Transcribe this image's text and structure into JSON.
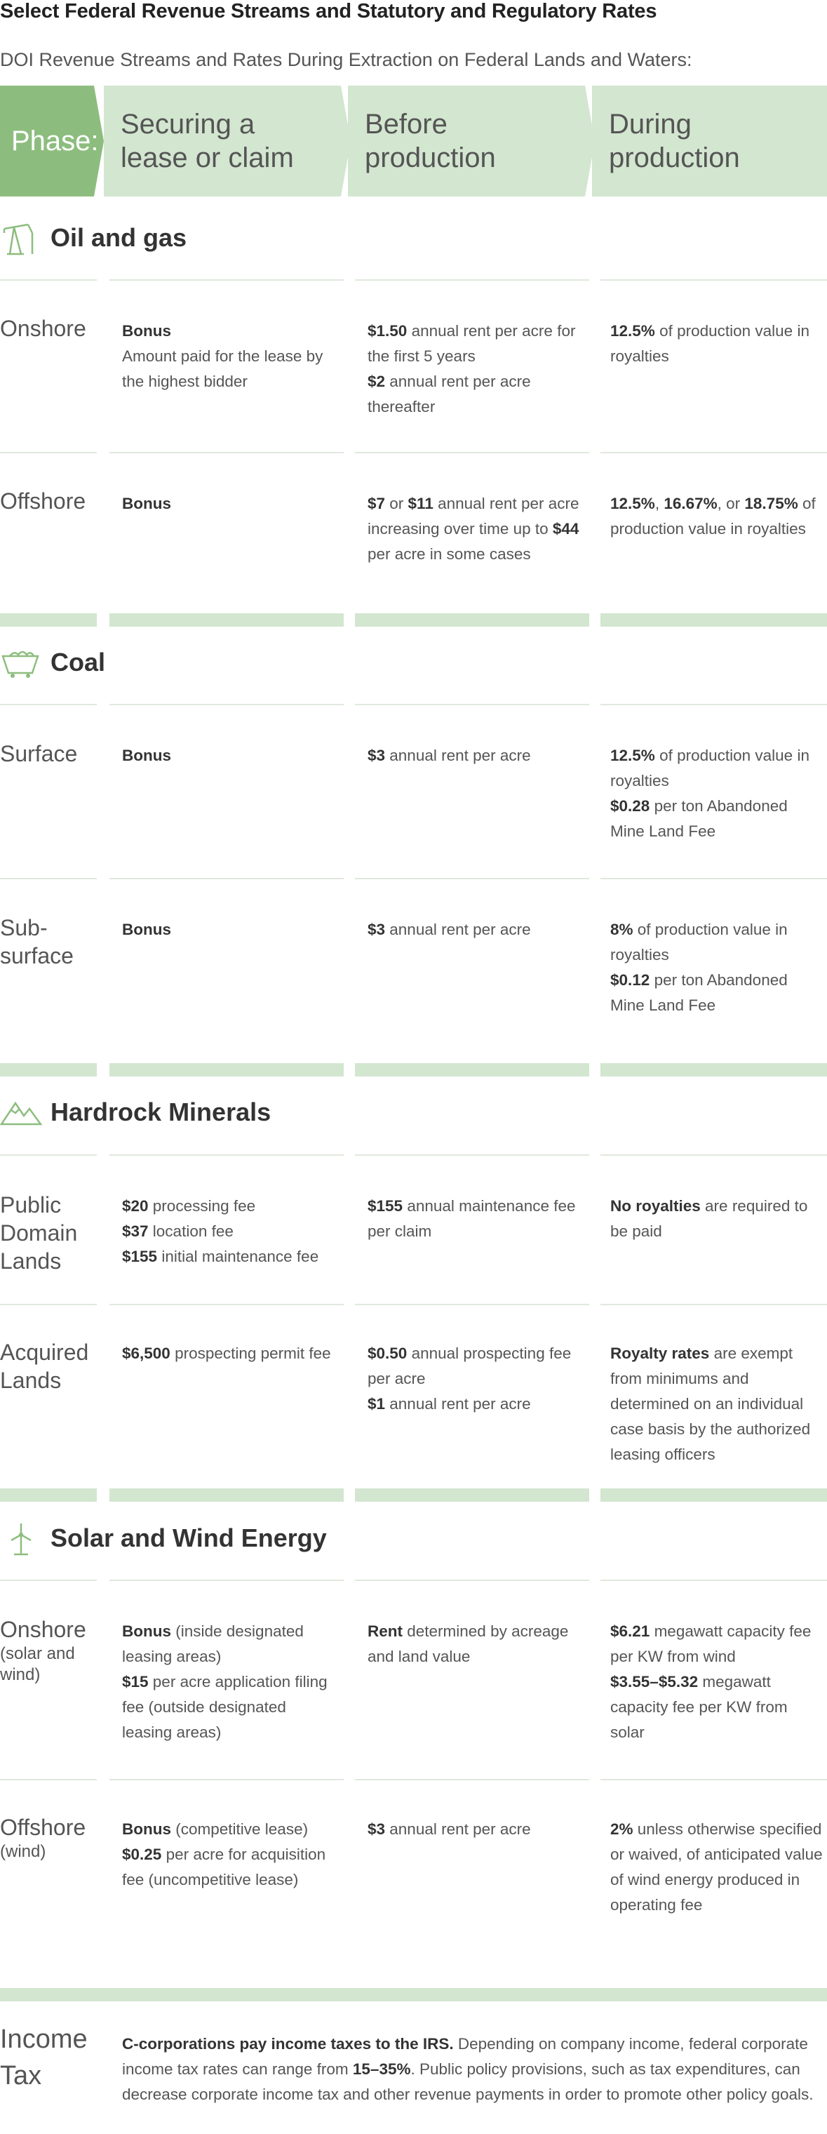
{
  "title": "Select Federal Revenue Streams and Statutory and Regulatory Rates",
  "subtitle": "DOI Revenue Streams and Rates During Extraction on Federal Lands and Waters:",
  "phases": {
    "label": "Phase:",
    "col1": [
      "Securing a",
      "lease or claim"
    ],
    "col2": [
      "Before",
      "production"
    ],
    "col3": [
      "During",
      "production"
    ]
  },
  "colors": {
    "accent_green": "#8dbd7e",
    "light_green": "#d3e6d0",
    "icon_green": "#8dbd7e"
  },
  "sections": {
    "oil_gas": {
      "icon": "oil-pump-icon",
      "title": "Oil and gas",
      "onshore": {
        "label": "Onshore",
        "c1_b": "Bonus",
        "c1_t": "Amount paid for the lease by the highest bidder",
        "c2_b1": "$1.50",
        "c2_t1": " annual rent per acre for the first 5 years",
        "c2_b2": "$2",
        "c2_t2": " annual rent per acre thereafter",
        "c3_b": "12.5%",
        "c3_t": " of production value in royalties"
      },
      "offshore": {
        "label": "Offshore",
        "c1_b": "Bonus",
        "c2_b1": "$7",
        "c2_t1": " or ",
        "c2_b2": "$11",
        "c2_t2": " annual rent per acre increasing over time up to ",
        "c2_b3": "$44",
        "c2_t3": " per acre in some cases",
        "c3_b1": "12.5%",
        "c3_t1": ", ",
        "c3_b2": "16.67%",
        "c3_t2": ", or ",
        "c3_b3": "18.75%",
        "c3_t3": " of production value in royalties"
      }
    },
    "coal": {
      "icon": "coal-cart-icon",
      "title": "Coal",
      "surface": {
        "label": "Surface",
        "c1_b": "Bonus",
        "c2_b": "$3",
        "c2_t": " annual rent per acre",
        "c3_b1": "12.5%",
        "c3_t1": " of production value in royalties",
        "c3_b2": "$0.28",
        "c3_t2": " per ton Abandoned Mine Land Fee"
      },
      "subsurface": {
        "label_1": "Sub-",
        "label_2": "surface",
        "c1_b": "Bonus",
        "c2_b": "$3",
        "c2_t": " annual rent per acre",
        "c3_b1": "8%",
        "c3_t1": " of production value in royalties",
        "c3_b2": "$0.12",
        "c3_t2": " per ton Abandoned Mine Land Fee"
      }
    },
    "hardrock": {
      "icon": "mountains-icon",
      "title": "Hardrock Minerals",
      "public": {
        "label_1": "Public",
        "label_2": "Domain",
        "label_3": "Lands",
        "c1_b1": "$20",
        "c1_t1": " processing fee",
        "c1_b2": "$37",
        "c1_t2": " location fee",
        "c1_b3": "$155",
        "c1_t3": " initial maintenance fee",
        "c2_b": "$155",
        "c2_t": " annual maintenance fee per claim",
        "c3_b": "No royalties",
        "c3_t": " are required to be paid"
      },
      "acquired": {
        "label_1": "Acquired",
        "label_2": "Lands",
        "c1_b": "$6,500",
        "c1_t": " prospecting permit fee",
        "c2_b1": "$0.50",
        "c2_t1": " annual prospecting fee per acre",
        "c2_b2": "$1",
        "c2_t2": " annual rent per acre",
        "c3_b": "Royalty rates",
        "c3_t": " are exempt from minimums and determined on an individual case basis by the authorized leasing officers"
      }
    },
    "solar_wind": {
      "icon": "wind-turbine-icon",
      "title": "Solar and Wind Energy",
      "onshore": {
        "label": "Onshore",
        "sub": "(solar and wind)",
        "c1_b1": "Bonus",
        "c1_t1": " (inside designated leasing areas)",
        "c1_b2": "$15",
        "c1_t2": " per acre application filing fee (outside designated leasing areas)",
        "c2_b": "Rent",
        "c2_t": " determined by acreage and land value",
        "c3_b1": "$6.21",
        "c3_t1": " megawatt capacity fee per KW from wind",
        "c3_b2": "$3.55–$5.32",
        "c3_t2": " megawatt capacity fee per KW from solar"
      },
      "offshore": {
        "label": "Offshore",
        "sub": "(wind)",
        "c1_b1": "Bonus",
        "c1_t1": " (competitive lease)",
        "c1_b2": "$0.25",
        "c1_t2": " per acre for acquisition fee (uncompetitive lease)",
        "c2_b": "$3",
        "c2_t": " annual rent per acre",
        "c3_b": "2%",
        "c3_t": " unless otherwise specified or waived, of anticipated value of wind energy produced in operating fee"
      }
    }
  },
  "income_tax": {
    "label_1": "Income",
    "label_2": "Tax",
    "b1": "C-corporations pay income taxes to the IRS.",
    "t1": " Depending on company income, federal corporate income tax rates can range from ",
    "b2": "15–35%",
    "t2": ". Public policy provisions, such as tax expenditures, can decrease corporate income tax and other revenue payments in order to promote other policy goals."
  }
}
